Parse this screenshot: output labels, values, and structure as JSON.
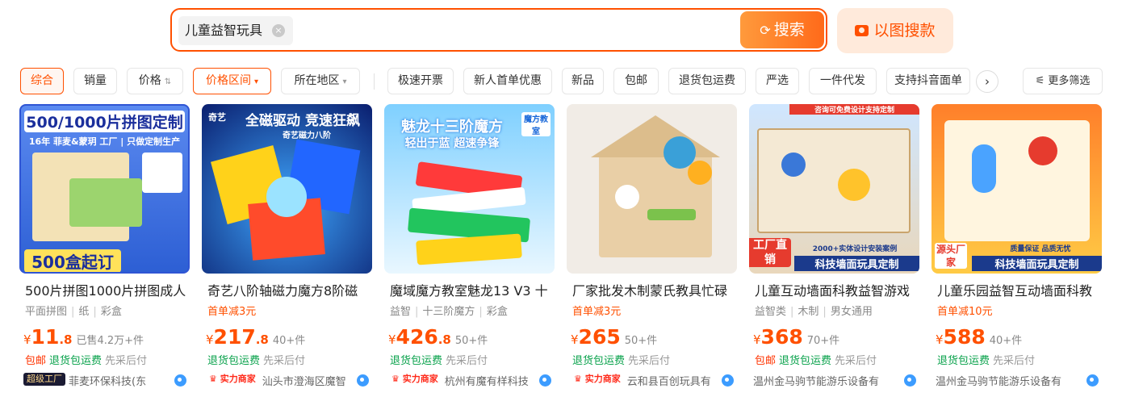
{
  "search": {
    "query": "儿童益智玩具",
    "clear_glyph": "×",
    "button_label": "搜索",
    "image_search_label": "以图搜款"
  },
  "filters": {
    "sort": [
      "综合",
      "销量",
      "价格"
    ],
    "price_range": "价格区间",
    "region": "所在地区",
    "tags": [
      "极速开票",
      "新人首单优惠",
      "新品",
      "包邮",
      "退货包运费",
      "严选",
      "一件代发",
      "支持抖音面单"
    ],
    "more_label": "更多筛选"
  },
  "products": [
    {
      "image_text": [
        "500/1000片拼图定制",
        "16年 菲麦&蒙玥 工厂",
        "只做定制生产",
        "500盒起订"
      ],
      "title": "500片拼图1000片拼图成人",
      "tags": [
        "平面拼图",
        "纸",
        "彩盒"
      ],
      "promo": "",
      "price_int": "11",
      "price_dec": ".8",
      "sold": "已售4.2万+件",
      "services": [
        "包邮",
        "退货包运费",
        "先采后付"
      ],
      "badge": "超级工厂",
      "shop": "菲麦环保科技(东"
    },
    {
      "image_text": [
        "奇艺",
        "全磁驱动 竞速狂飙",
        "奇艺磁力八阶"
      ],
      "title": "奇艺八阶轴磁力魔方8阶磁",
      "tags": [],
      "promo": "首单减3元",
      "price_int": "217",
      "price_dec": ".8",
      "sold": "40+件",
      "services": [
        "退货包运费",
        "先采后付"
      ],
      "badge": "实力商家",
      "shop": "汕头市澄海区魔智"
    },
    {
      "image_text": [
        "魅龙十三阶魔方",
        "轻出于蓝 超速争锋",
        "魔方教室"
      ],
      "title": "魔域魔方教室魅龙13 V3 十",
      "tags": [
        "益智",
        "十三阶魔方",
        "彩盒"
      ],
      "promo": "",
      "price_int": "426",
      "price_dec": ".8",
      "sold": "50+件",
      "services": [
        "退货包运费",
        "先采后付"
      ],
      "badge": "实力商家",
      "shop": "杭州有魔有样科技"
    },
    {
      "image_text": [],
      "title": "厂家批发木制蒙氏教具忙碌",
      "tags": [],
      "promo": "首单减3元",
      "price_int": "265",
      "price_dec": "",
      "sold": "50+件",
      "services": [
        "退货包运费",
        "先采后付"
      ],
      "badge": "实力商家",
      "shop": "云和县百创玩具有"
    },
    {
      "image_text": [
        "咨询可免费设计支持定制",
        "工厂直销",
        "2000+实体设计安装案例",
        "科技墙面玩具定制"
      ],
      "title": "儿童互动墙面科教益智游戏",
      "tags": [
        "益智类",
        "木制",
        "男女通用"
      ],
      "promo": "",
      "price_int": "368",
      "price_dec": "",
      "sold": "70+件",
      "services": [
        "包邮",
        "退货包运费",
        "先采后付"
      ],
      "badge": "",
      "shop": "温州金马驹节能游乐设备有"
    },
    {
      "image_text": [
        "源头厂家",
        "质量保证 品质无忧",
        "科技墙面玩具定制"
      ],
      "title": "儿童乐园益智互动墙面科教",
      "tags": [],
      "promo": "首单减10元",
      "price_int": "588",
      "price_dec": "",
      "sold": "40+件",
      "services": [
        "退货包运费",
        "先采后付"
      ],
      "badge": "",
      "shop": "温州金马驹节能游乐设备有"
    }
  ],
  "colors": {
    "accent": "#ff5000",
    "green": "#07a14a"
  }
}
